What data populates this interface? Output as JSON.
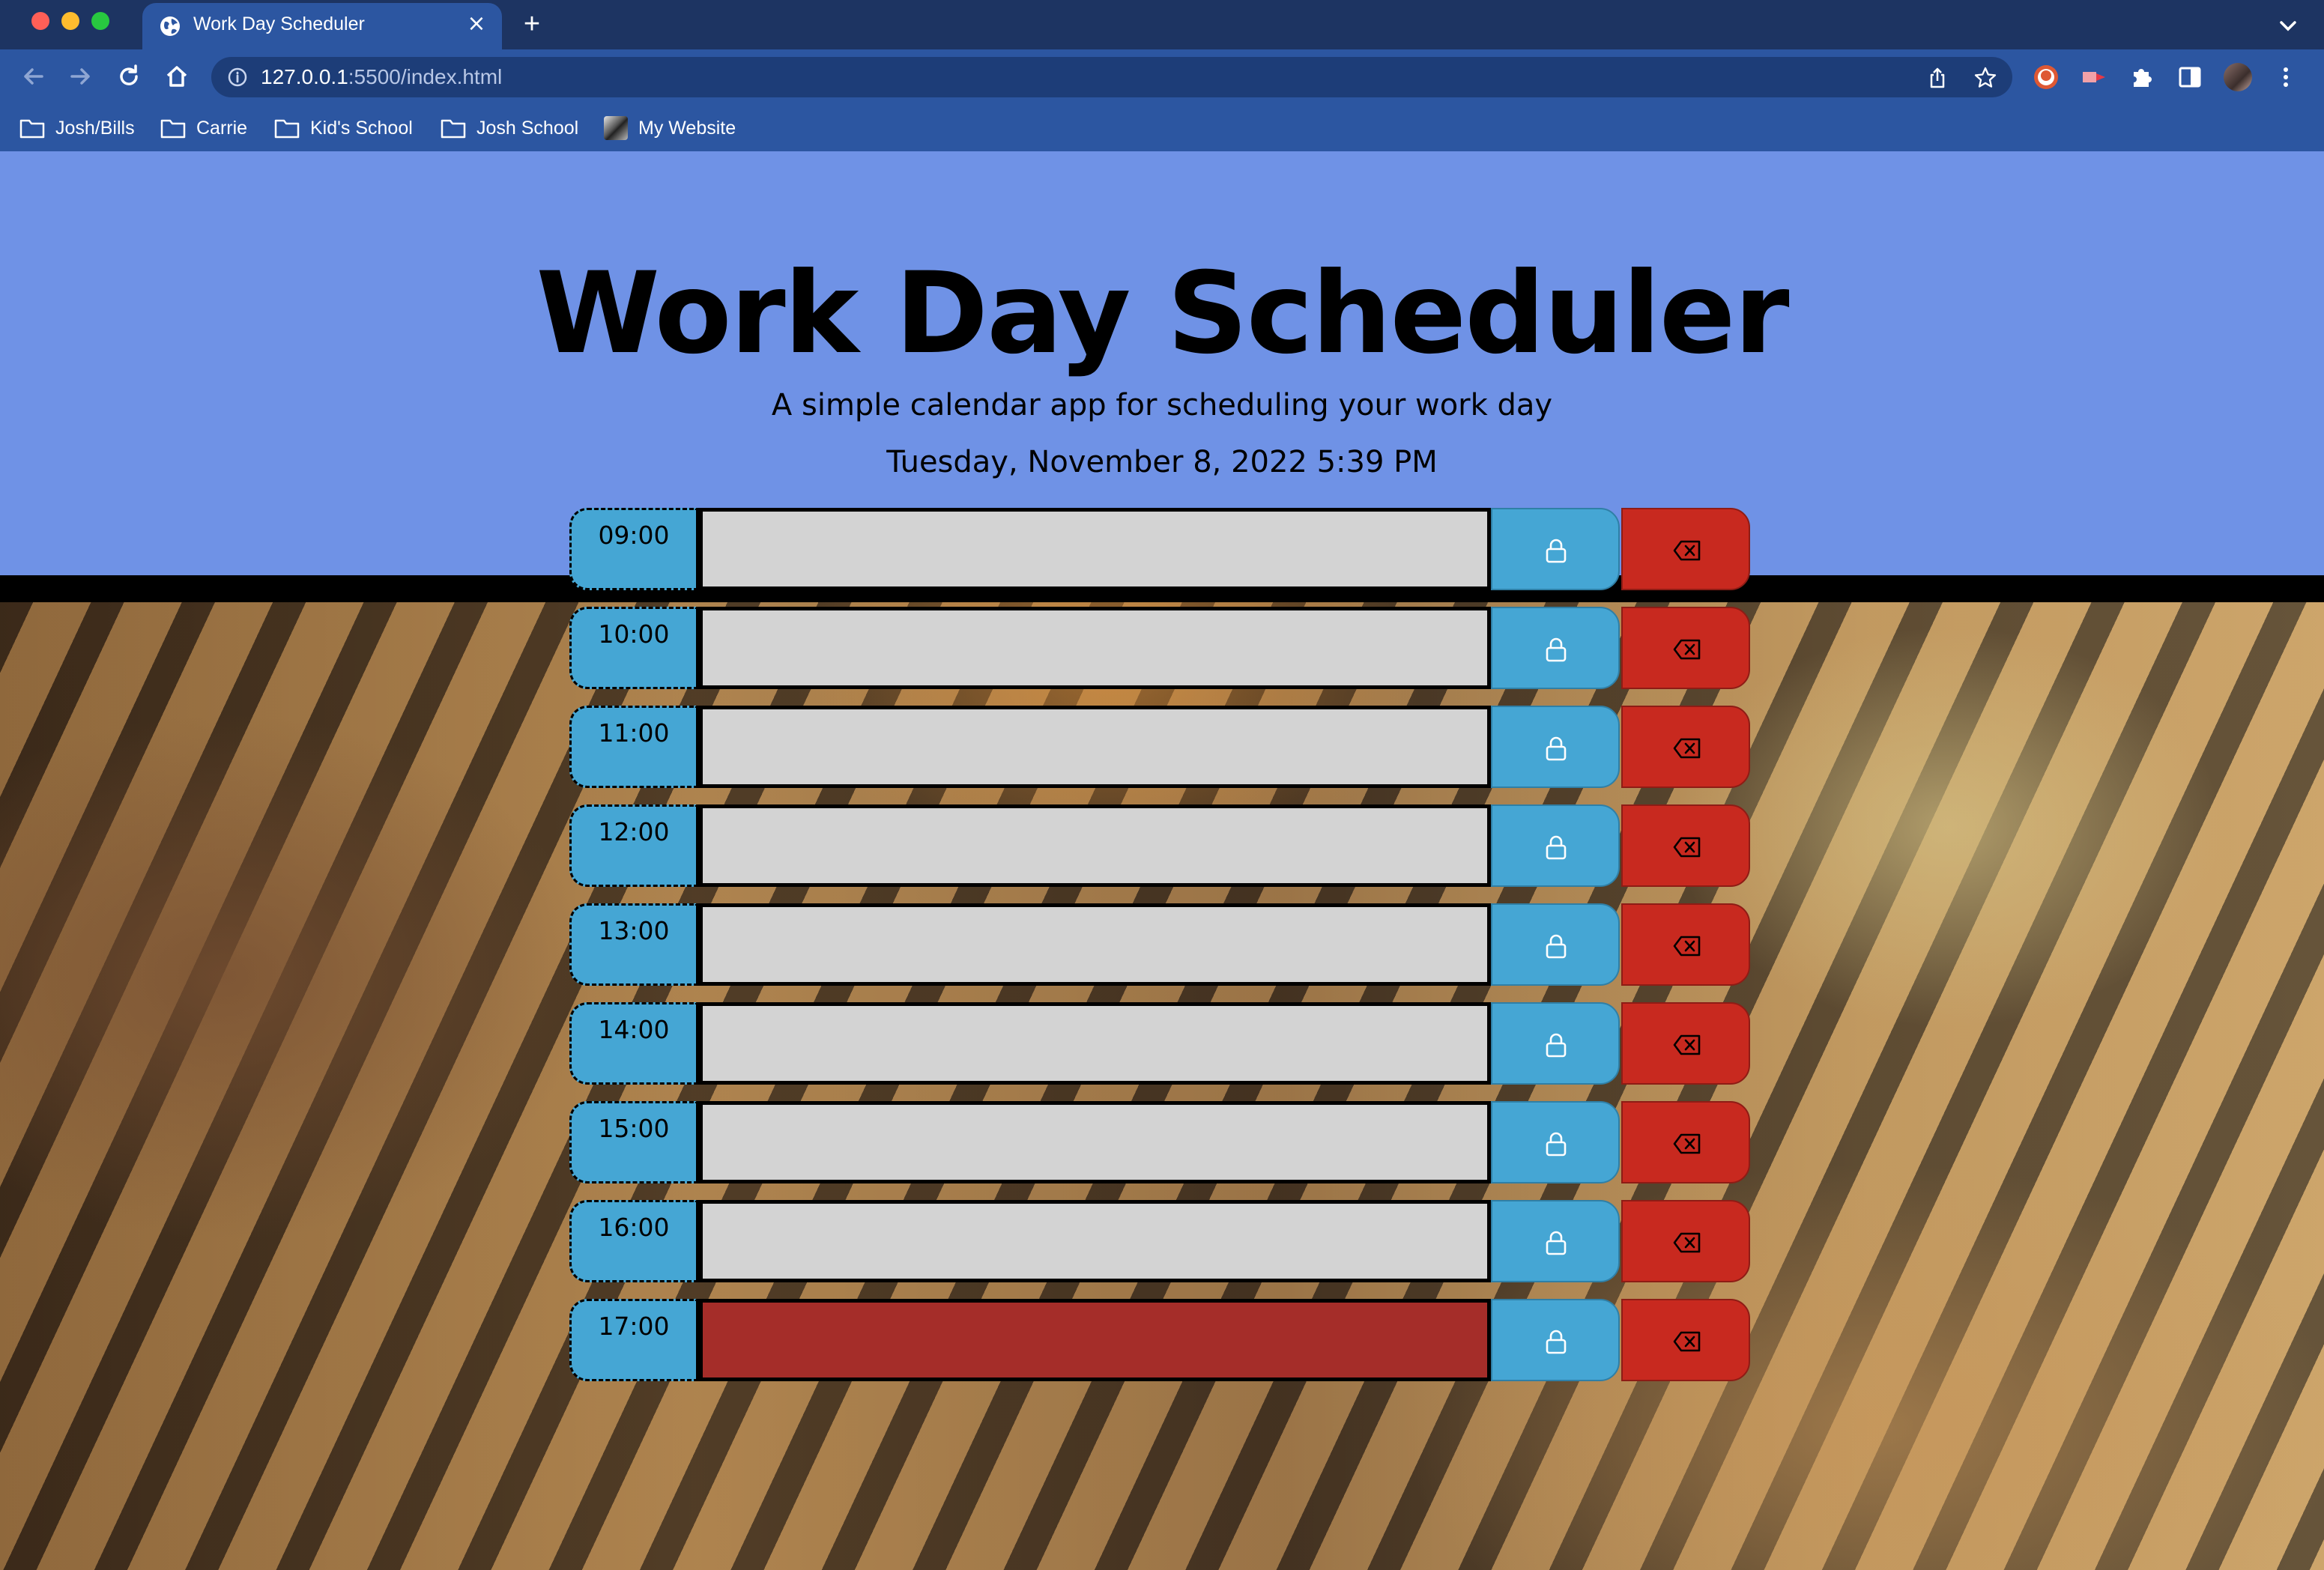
{
  "browser": {
    "tab_title": "Work Day Scheduler",
    "new_tab_label": "+",
    "tab_close_label": "×",
    "url_host": "127.0.0.1",
    "url_path": ":5500/index.html",
    "bookmarks": [
      "Josh/Bills",
      "Carrie",
      "Kid's School",
      "Josh School",
      "My Website"
    ]
  },
  "header": {
    "title": "Work Day Scheduler",
    "subtitle": "A simple calendar app for scheduling your work day",
    "datetime": "Tuesday, November 8, 2022 5:39 PM"
  },
  "schedule": {
    "rows": [
      {
        "hour": "09:00",
        "text": "",
        "state": "past"
      },
      {
        "hour": "10:00",
        "text": "",
        "state": "past"
      },
      {
        "hour": "11:00",
        "text": "",
        "state": "past"
      },
      {
        "hour": "12:00",
        "text": "",
        "state": "past"
      },
      {
        "hour": "13:00",
        "text": "",
        "state": "past"
      },
      {
        "hour": "14:00",
        "text": "",
        "state": "past"
      },
      {
        "hour": "15:00",
        "text": "",
        "state": "past"
      },
      {
        "hour": "16:00",
        "text": "",
        "state": "past"
      },
      {
        "hour": "17:00",
        "text": "",
        "state": "present"
      }
    ],
    "save_icon": "lock-icon",
    "delete_icon": "backspace-icon"
  },
  "colors": {
    "header_bg": "#6f92e6",
    "hour_bg": "#45a6d4",
    "past_bg": "#d3d3d3",
    "present_bg": "#a52d29",
    "save_bg": "#45a6d4",
    "delete_bg": "#c8291f"
  }
}
